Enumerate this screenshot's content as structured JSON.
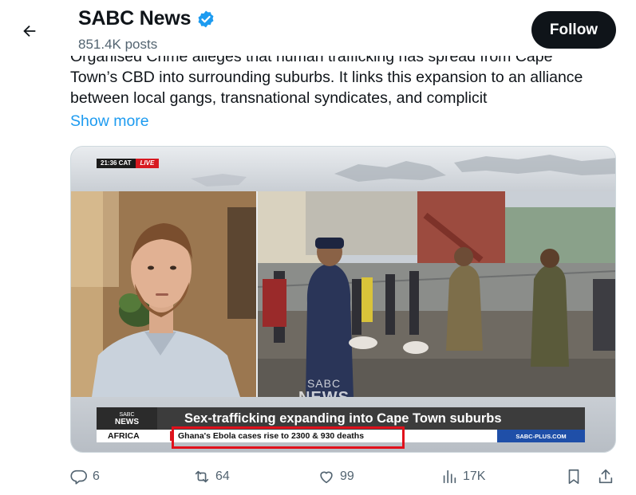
{
  "header": {
    "account_name": "SABC News",
    "post_count": "851.4K posts",
    "follow_label": "Follow"
  },
  "tweet": {
    "lines": [
      "Organised Crime alleges that human trafficking has spread from Cape",
      "Town’s CBD into surrounding suburbs. It links this expansion to an alliance",
      "between local gangs, transnational syndicates, and complicit"
    ],
    "show_more": "Show more"
  },
  "media": {
    "time": "21:36 CAT",
    "live": "LIVE",
    "watermark_brand": "SABC",
    "watermark_name": "NEWS",
    "logo_small": "SABC",
    "logo_name": "NEWS",
    "headline": "Sex-trafficking expanding into Cape Town suburbs",
    "region": "AFRICA",
    "ticker": "Ghana's Ebola cases rise to 2300 & 930 deaths",
    "site": "SABC-PLUS.COM"
  },
  "actions": {
    "replies": "6",
    "reposts": "64",
    "likes": "99",
    "views": "17K"
  },
  "colors": {
    "accent": "#1d9bf0",
    "follow_bg": "#0f1419",
    "secondary_text": "#536471",
    "highlight": "#e1101b"
  }
}
